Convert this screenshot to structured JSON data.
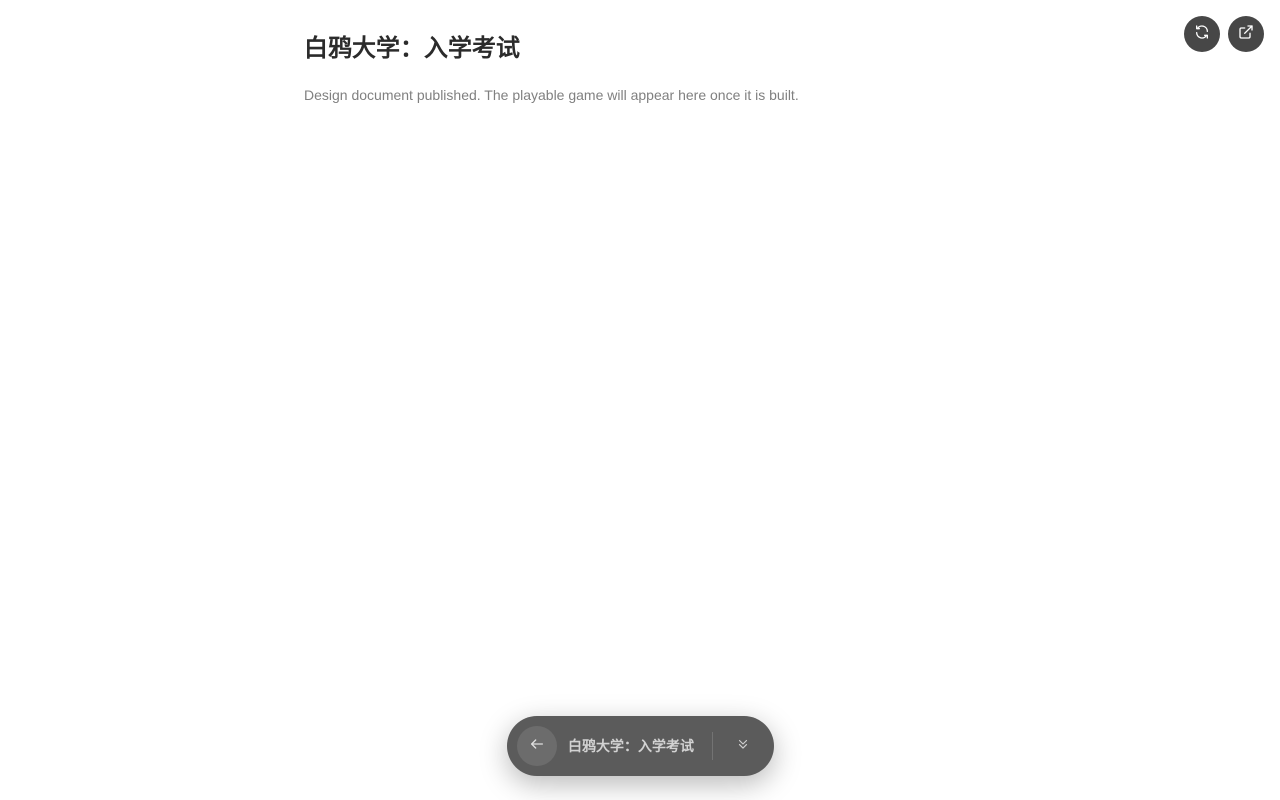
{
  "page": {
    "title": "白鸦大学：入学考试",
    "subtitle": "Design document published. The playable game will appear here once it is built."
  },
  "top_actions": [
    {
      "name": "refresh",
      "icon": "refresh-icon"
    },
    {
      "name": "open-external",
      "icon": "external-link-icon"
    }
  ],
  "pill": {
    "title": "白鸦大学：入学考试",
    "back_icon": "arrow-left-icon",
    "expand_icon": "chevrons-down-icon"
  },
  "colors": {
    "background": "#ffffff",
    "title": "#2b2b2b",
    "subtitle": "#808080",
    "button_bg": "#474747",
    "pill_bg": "#5b5b5b",
    "pill_text": "#d2d2d2"
  }
}
